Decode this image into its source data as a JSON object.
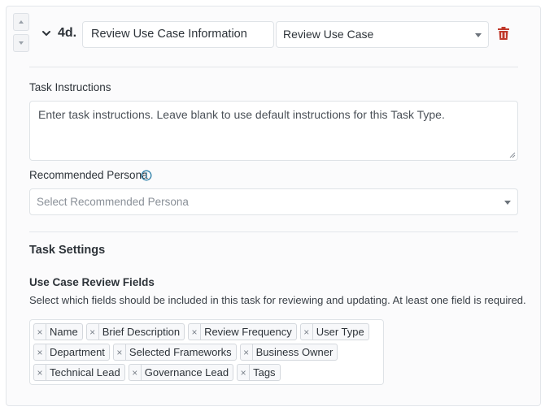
{
  "task": {
    "step_number": "4d.",
    "name_value": "Review Use Case Information",
    "type_value": "Review Use Case",
    "icons": {
      "move_up": "caret-up-icon",
      "move_down": "caret-down-icon",
      "collapse": "chevron-down-icon",
      "delete": "trash-icon"
    },
    "delete_color": "#c0392b"
  },
  "instructions": {
    "label": "Task Instructions",
    "placeholder": "Enter task instructions. Leave blank to use default instructions for this Task Type."
  },
  "persona": {
    "label": "Recommended Persona",
    "info_icon": "info-icon",
    "placeholder": "Select Recommended Persona"
  },
  "settings": {
    "title": "Task Settings",
    "fields_label": "Use Case Review Fields",
    "help_text": "Select which fields should be included in this task for reviewing and updating. At least one field is required.",
    "tag_remove_glyph": "×",
    "selected_fields": [
      "Name",
      "Brief Description",
      "Review Frequency",
      "User Type",
      "Department",
      "Selected Frameworks",
      "Business Owner",
      "Technical Lead",
      "Governance Lead",
      "Tags"
    ]
  },
  "colors": {
    "accent_info": "#2f80a8",
    "text": "#2d3339",
    "border": "#dfe3e7"
  }
}
